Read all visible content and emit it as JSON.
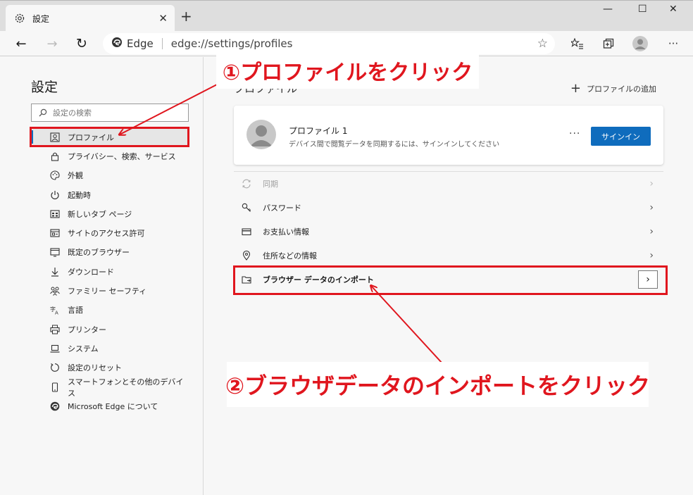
{
  "tab": {
    "title": "設定",
    "icon": "gear-icon",
    "close": "✕"
  },
  "window": {
    "new_tab": "+",
    "minimize": "—",
    "maximize": "☐",
    "close": "✕"
  },
  "toolbar": {
    "back": "←",
    "forward": "→",
    "refresh": "↻",
    "more": "···"
  },
  "address": {
    "app_label": "Edge",
    "url": "edge://settings/profiles",
    "favorite": "☆"
  },
  "sidebar": {
    "title": "設定",
    "search_placeholder": "設定の検索",
    "items": [
      {
        "label": "プロファイル",
        "icon": "profile-icon",
        "active": true
      },
      {
        "label": "プライバシー、検索、サービス",
        "icon": "lock-icon"
      },
      {
        "label": "外観",
        "icon": "palette-icon"
      },
      {
        "label": "起動時",
        "icon": "power-icon"
      },
      {
        "label": "新しいタブ ページ",
        "icon": "new-tab-page-icon"
      },
      {
        "label": "サイトのアクセス許可",
        "icon": "site-permissions-icon"
      },
      {
        "label": "既定のブラウザー",
        "icon": "default-browser-icon"
      },
      {
        "label": "ダウンロード",
        "icon": "download-icon"
      },
      {
        "label": "ファミリー セーフティ",
        "icon": "family-icon"
      },
      {
        "label": "言語",
        "icon": "language-icon"
      },
      {
        "label": "プリンター",
        "icon": "printer-icon"
      },
      {
        "label": "システム",
        "icon": "system-icon"
      },
      {
        "label": "設定のリセット",
        "icon": "reset-icon"
      },
      {
        "label": "スマートフォンとその他のデバイス",
        "icon": "phone-icon"
      },
      {
        "label": "Microsoft Edge について",
        "icon": "edge-logo-icon"
      }
    ]
  },
  "main": {
    "section_title": "プロファイル",
    "add_profile": "プロファイルの追加",
    "profile": {
      "name": "プロファイル 1",
      "description": "デバイス間で閲覧データを同期するには、サインインしてください",
      "more": "···",
      "signin_label": "サインイン"
    },
    "rows": [
      {
        "label": "同期",
        "icon": "sync-icon",
        "disabled": true
      },
      {
        "label": "パスワード",
        "icon": "key-icon"
      },
      {
        "label": "お支払い情報",
        "icon": "card-icon"
      },
      {
        "label": "住所などの情報",
        "icon": "location-icon"
      },
      {
        "label": "ブラウザー データのインポート",
        "icon": "import-icon"
      }
    ],
    "chevron": "›"
  },
  "annotations": {
    "step1": "①プロファイルをクリック",
    "step2": "②ブラウザデータのインポートをクリック",
    "color": "#e0161e"
  },
  "colors": {
    "accent": "#0f6cbd",
    "annotation": "#e0161e"
  }
}
